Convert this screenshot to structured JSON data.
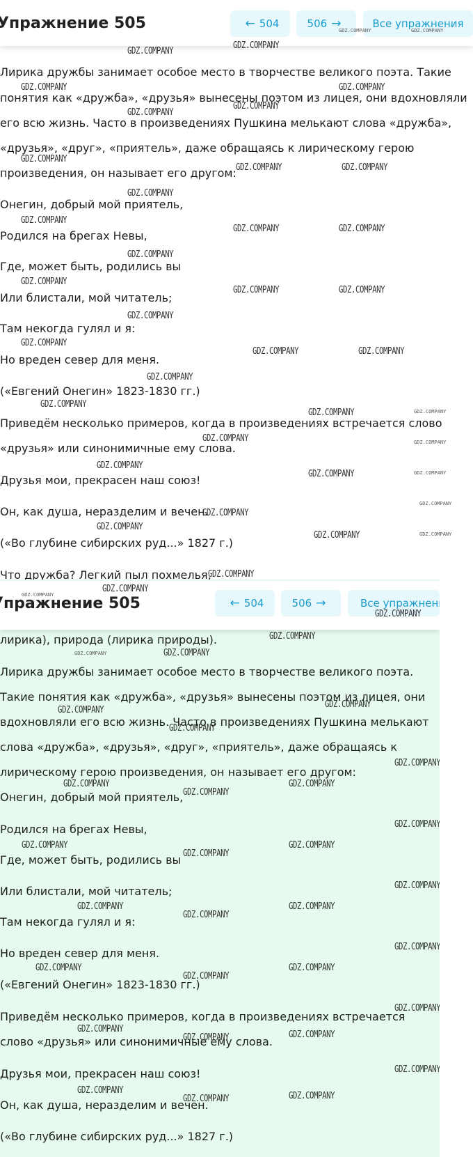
{
  "panel1": {
    "title": "Упражнение 505",
    "prev": "504",
    "next": "506",
    "all": "Все упражнения",
    "lines": [
      "Лирика дружбы занимает особое место в творчестве великого поэта. Такие",
      "понятия как «дружба», «друзья» вынесены поэтом из лицея, они вдохновляли",
      "его всю жизнь. Часто в произведениях Пушкина мелькают слова «дружба»,",
      "«друзья», «друг», «приятель», даже обращаясь к лирическому герою",
      "произведения, он называет его другом:",
      "Онегин, добрый мой приятель,",
      "Родился на брегах Невы,",
      "Где, может быть, родились вы",
      "Или блистали, мой читатель;",
      "Там некогда гулял и я:",
      "Но вреден север для меня.",
      "(«Евгений Онегин» 1823-1830 гг.)",
      "Приведём несколько примеров, когда в произведениях встречается слово",
      "«друзья» или синонимичные ему слова.",
      "Друзья мои, прекрасен наш союз!",
      "Он, как душа, неразделим и вечен.",
      "(«Во глубине сибирских руд...» 1827 г.)",
      "Что дружба? Легкий пыл похмелья,"
    ]
  },
  "panel2": {
    "title": "Упражнение 505",
    "prev": "504",
    "next": "506",
    "all": "Все упражнения",
    "lines": [
      "лирика), природа (лирика природы).",
      "Лирика дружбы занимает особое место в творчестве великого поэта.",
      "Такие понятия как «дружба», «друзья» вынесены поэтом из лицея, они",
      "вдохновляли его всю жизнь. Часто в произведениях Пушкина мелькают",
      "слова «дружба», «друзья», «друг», «приятель», даже обращаясь к",
      "лирическому герою произведения, он называет его другом:",
      "Онегин, добрый мой приятель,",
      "Родился на брегах Невы,",
      "Где, может быть, родились вы",
      "Или блистали, мой читатель;",
      "Там некогда гулял и я:",
      "Но вреден север для меня.",
      "(«Евгений Онегин» 1823-1830 гг.)",
      "Приведём несколько примеров, когда в произведениях встречается",
      "слово «друзья» или синонимичные ему слова.",
      "Друзья мои, прекрасен наш союз!",
      "Он, как душа, неразделим и вечен.",
      "(«Во глубине сибирских руд...» 1827 г.)"
    ]
  },
  "watermark": "GDZ.COMPANY"
}
